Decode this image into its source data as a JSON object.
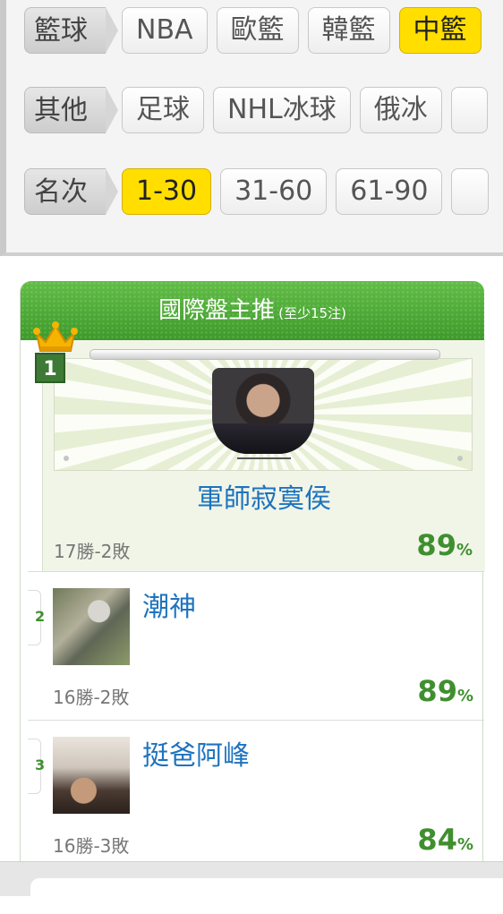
{
  "filters": {
    "basketball": {
      "label": "籃球",
      "items": [
        {
          "label": "NBA",
          "active": false
        },
        {
          "label": "歐籃",
          "active": false
        },
        {
          "label": "韓籃",
          "active": false
        },
        {
          "label": "中籃",
          "active": true
        }
      ]
    },
    "other": {
      "label": "其他",
      "items": [
        {
          "label": "足球",
          "active": false
        },
        {
          "label": "NHL冰球",
          "active": false
        },
        {
          "label": "俄冰",
          "active": false
        }
      ]
    },
    "rank": {
      "label": "名次",
      "items": [
        {
          "label": "1-30",
          "active": true
        },
        {
          "label": "31-60",
          "active": false
        },
        {
          "label": "61-90",
          "active": false
        }
      ]
    }
  },
  "card": {
    "title": "國際盤主推",
    "subtitle": "(至少15注)",
    "percent_unit": "%",
    "entries": [
      {
        "rank": "1",
        "name": "軍師寂寞侯",
        "record": "17勝-2敗",
        "percent": "89"
      },
      {
        "rank": "2",
        "name": "潮神",
        "record": "16勝-2敗",
        "percent": "89"
      },
      {
        "rank": "3",
        "name": "挺爸阿峰",
        "record": "16勝-3敗",
        "percent": "84"
      }
    ]
  },
  "colors": {
    "active_chip": "#ffde00",
    "header_green": "#4aa733",
    "name_blue": "#1e73be",
    "percent_green": "#3f8f2f"
  }
}
